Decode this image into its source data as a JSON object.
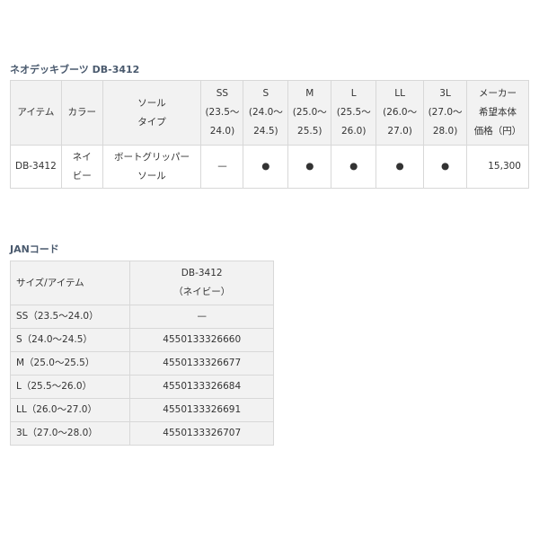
{
  "product_section": {
    "title": "ネオデッキブーツ DB-3412",
    "headers": {
      "item": "アイテム",
      "color": "カラー",
      "sole_type": [
        "ソール",
        "タイプ"
      ],
      "sizes": [
        {
          "label": "SS",
          "range_a": "(23.5～",
          "range_b": "24.0)"
        },
        {
          "label": "S",
          "range_a": "(24.0～",
          "range_b": "24.5)"
        },
        {
          "label": "M",
          "range_a": "(25.0～",
          "range_b": "25.5)"
        },
        {
          "label": "L",
          "range_a": "(25.5～",
          "range_b": "26.0)"
        },
        {
          "label": "LL",
          "range_a": "(26.0～",
          "range_b": "27.0)"
        },
        {
          "label": "3L",
          "range_a": "(27.0～",
          "range_b": "28.0)"
        }
      ],
      "price": [
        "メーカー",
        "希望本体",
        "価格（円）"
      ]
    },
    "row": {
      "item": "DB-3412",
      "color": [
        "ネイ",
        "ビー"
      ],
      "sole_type": [
        "ボートグリッパー",
        "ソール"
      ],
      "availability": [
        "—",
        "●",
        "●",
        "●",
        "●",
        "●"
      ],
      "price": "15,300"
    }
  },
  "jan_section": {
    "title": "JANコード",
    "header_left": "サイズ/アイテム",
    "header_right": [
      "DB-3412",
      "（ネイビー）"
    ],
    "rows": [
      {
        "size": "SS（23.5～24.0）",
        "code": "—"
      },
      {
        "size": "S（24.0～24.5）",
        "code": "4550133326660"
      },
      {
        "size": "M（25.0～25.5）",
        "code": "4550133326677"
      },
      {
        "size": "L（25.5～26.0）",
        "code": "4550133326684"
      },
      {
        "size": "LL（26.0～27.0）",
        "code": "4550133326691"
      },
      {
        "size": "3L（27.0～28.0）",
        "code": "4550133326707"
      }
    ]
  }
}
